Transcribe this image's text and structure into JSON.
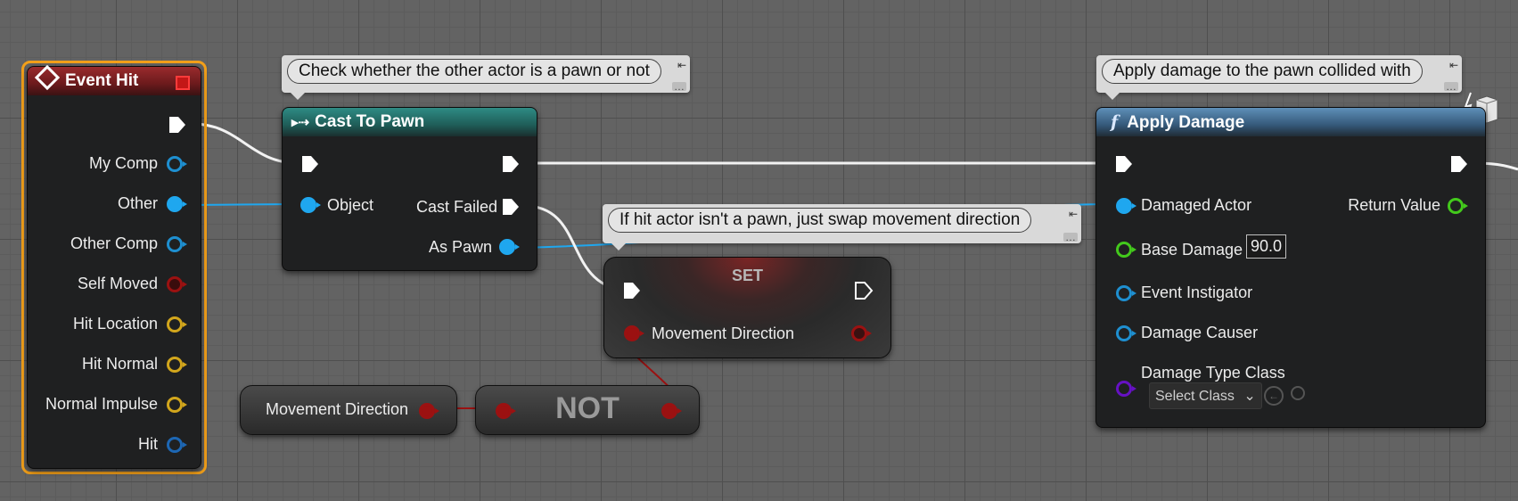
{
  "colors": {
    "exec": "#ffffff",
    "object_pin": "#1fa7ef",
    "component_pin": "#1e8fd0",
    "boolean_pin": "#9b1111",
    "vector_pin": "#d2a61c",
    "float_pin": "#43c91c",
    "class_pin": "#6611c4",
    "struct_pin": "#1d67b4",
    "selection": "#f3a01a"
  },
  "event_hit": {
    "title": "Event Hit",
    "pins": [
      {
        "label": "My Comp",
        "type": "component"
      },
      {
        "label": "Other",
        "type": "object"
      },
      {
        "label": "Other Comp",
        "type": "component"
      },
      {
        "label": "Self Moved",
        "type": "boolean"
      },
      {
        "label": "Hit Location",
        "type": "vector"
      },
      {
        "label": "Hit Normal",
        "type": "vector"
      },
      {
        "label": "Normal Impulse",
        "type": "vector"
      },
      {
        "label": "Hit",
        "type": "struct"
      }
    ]
  },
  "cast_to_pawn": {
    "title": "Cast To Pawn",
    "icon": "cast-arrows-icon",
    "object_label": "Object",
    "cast_failed_label": "Cast Failed",
    "as_pawn_label": "As Pawn"
  },
  "apply_damage": {
    "title": "Apply Damage",
    "icon": "function-icon",
    "damaged_actor_label": "Damaged Actor",
    "return_value_label": "Return Value",
    "base_damage_label": "Base Damage",
    "base_damage_value": "90.0",
    "event_instigator_label": "Event Instigator",
    "damage_causer_label": "Damage Causer",
    "damage_type_class_label": "Damage Type Class",
    "select_class_label": "Select Class"
  },
  "set_node": {
    "title": "SET",
    "variable_label": "Movement Direction"
  },
  "getter_node": {
    "variable_label": "Movement Direction"
  },
  "not_node": {
    "title": "NOT"
  },
  "comments": {
    "cast": "Check whether the other actor is a pawn or not",
    "damage": "Apply damage to the pawn collided with",
    "swap": "If hit actor isn't a pawn, just swap movement direction"
  }
}
